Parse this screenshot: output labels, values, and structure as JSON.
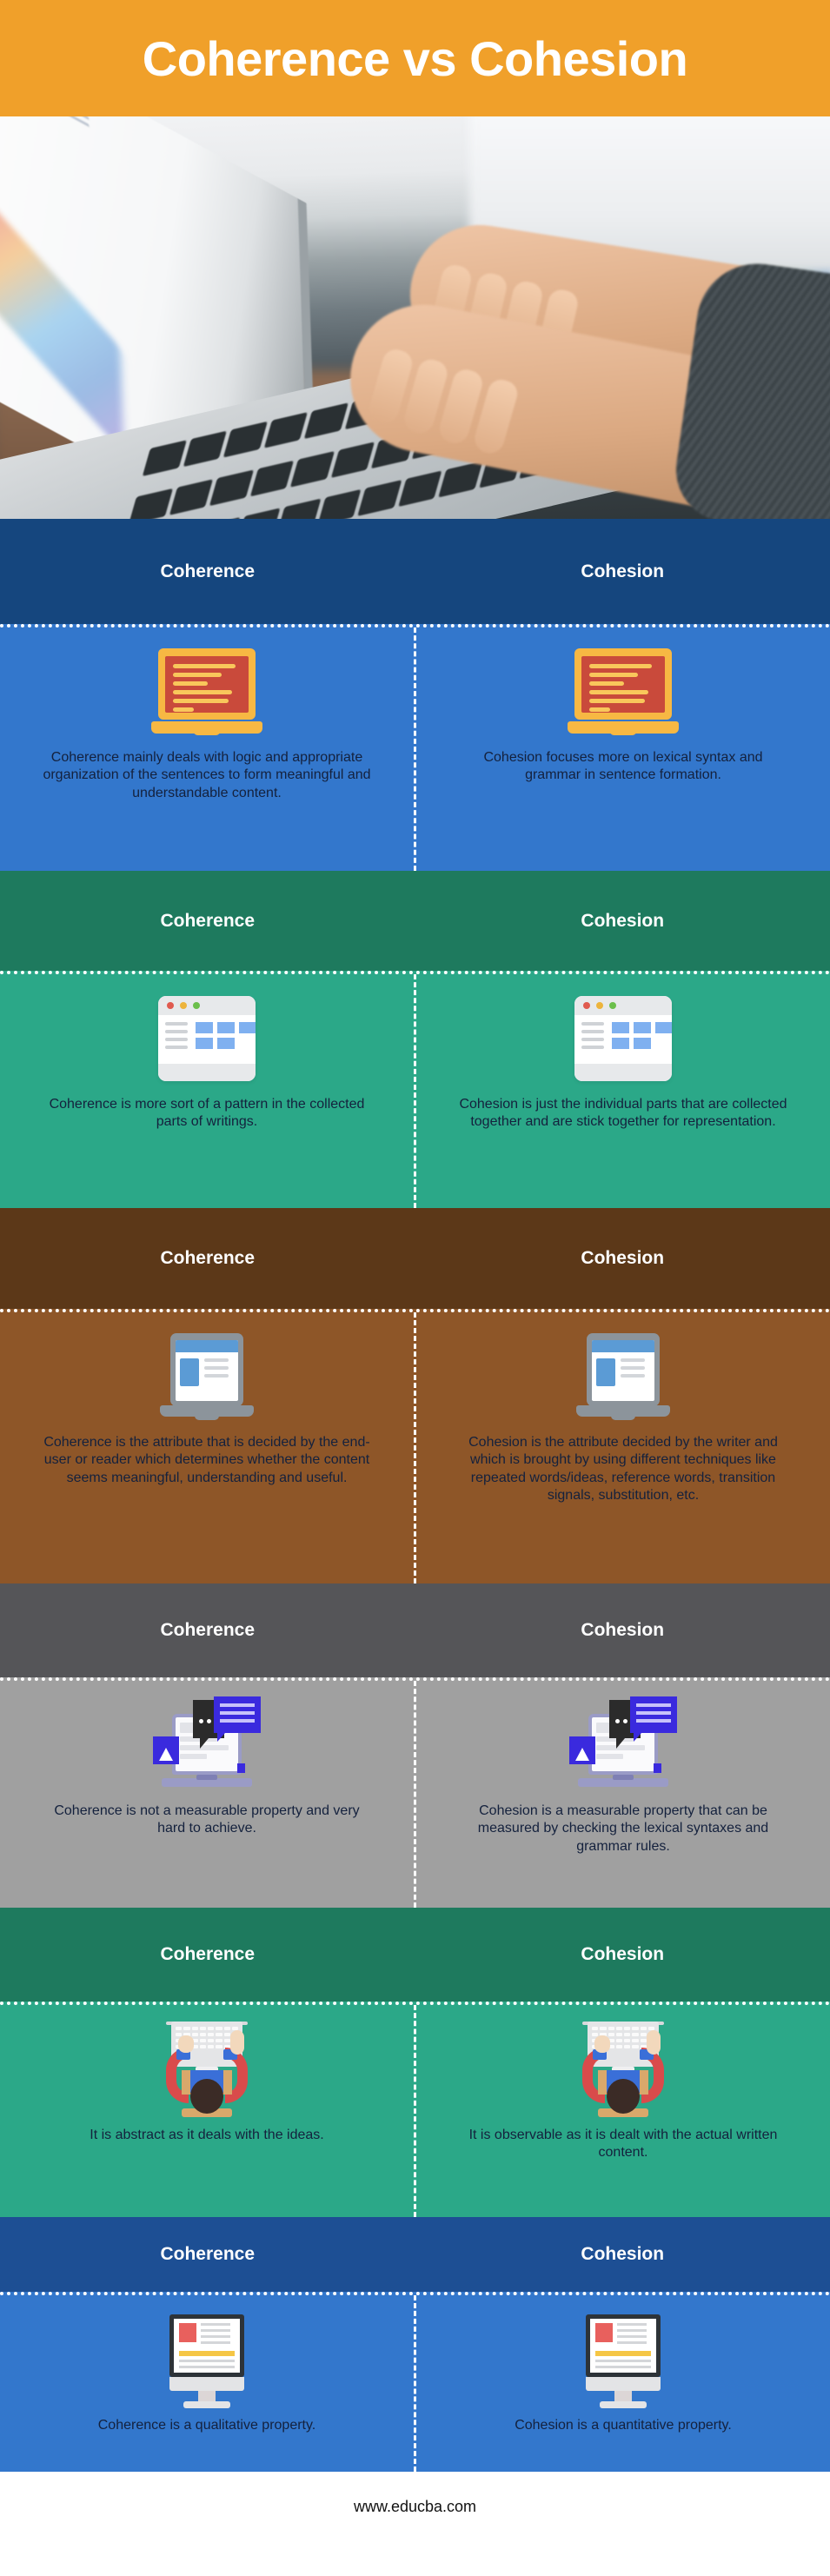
{
  "title": "Coherence vs Cohesion",
  "hero": {
    "alt": "hands typing on a laptop keyboard"
  },
  "labels": {
    "left": "Coherence",
    "right": "Cohesion"
  },
  "colors": {
    "title_bg": "#F0A02A",
    "title_text": "#FFFFFF",
    "body_text": "#14213D",
    "divider": "#FFFFFF"
  },
  "sections": [
    {
      "header_bg": "#15467E",
      "body_bg": "#3377CC",
      "icon": "laptop-code-icon",
      "left": {
        "label": "Coherence",
        "text": "Coherence mainly deals with logic and appropriate organization of the sentences to form meaningful and understandable content."
      },
      "right": {
        "label": "Cohesion",
        "text": "Cohesion focuses more on lexical syntax and grammar in sentence formation."
      }
    },
    {
      "header_bg": "#1E7A5E",
      "body_bg": "#2BA888",
      "icon": "browser-window-icon",
      "left": {
        "label": "Coherence",
        "text": "Coherence is more sort of a pattern in the collected parts of writings."
      },
      "right": {
        "label": "Cohesion",
        "text": "Cohesion is just the individual parts that are collected together and are stick together for representation."
      }
    },
    {
      "header_bg": "#5C3818",
      "body_bg": "#8E5628",
      "icon": "tablet-article-icon",
      "left": {
        "label": "Coherence",
        "text": "Coherence is the attribute that is decided by the end-user or reader which determines whether the content seems meaningful, understanding and useful."
      },
      "right": {
        "label": "Cohesion",
        "text": "Cohesion is the attribute decided by the writer and which is brought by using different techniques like repeated words/ideas, reference words, transition signals, substitution, etc."
      }
    },
    {
      "header_bg": "#555558",
      "body_bg": "#A0A0A0",
      "icon": "laptop-chat-icon",
      "left": {
        "label": "Coherence",
        "text": "Coherence is not a measurable property and very hard to achieve."
      },
      "right": {
        "label": "Cohesion",
        "text": "Cohesion is a measurable property that can be measured by checking the lexical syntaxes and grammar rules."
      }
    },
    {
      "header_bg": "#1E7A5E",
      "body_bg": "#2BA888",
      "icon": "person-typing-icon",
      "left": {
        "label": "Coherence",
        "text": "It is abstract as it deals with the ideas."
      },
      "right": {
        "label": "Cohesion",
        "text": "It is observable as it is dealt with the actual written content."
      }
    },
    {
      "header_bg": "#1D4F94",
      "body_bg": "#3377CC",
      "icon": "monitor-article-icon",
      "left": {
        "label": "Coherence",
        "text": "Coherence is a qualitative property."
      },
      "right": {
        "label": "Cohesion",
        "text": "Cohesion is a quantitative property."
      }
    }
  ],
  "footer": {
    "url": "www.educba.com"
  }
}
